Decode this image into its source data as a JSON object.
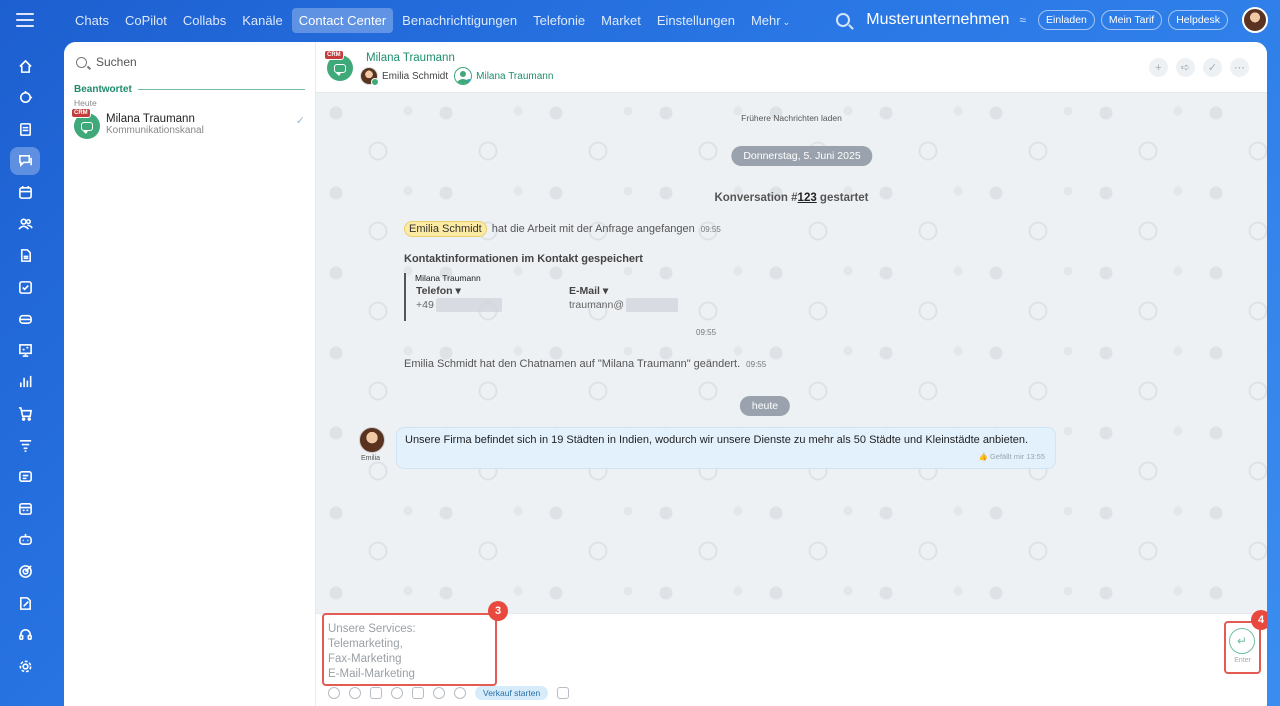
{
  "topnav": {
    "items": [
      "Chats",
      "CoPilot",
      "Collabs",
      "Kanäle",
      "Contact Center",
      "Benachrichtigungen",
      "Telefonie",
      "Market",
      "Einstellungen",
      "Mehr"
    ],
    "active_index": 4,
    "company": "Musterunternehmen",
    "buttons": [
      "Einladen",
      "Mein Tarif",
      "Helpdesk"
    ]
  },
  "sidebar_icons": [
    "home-icon",
    "puzzle-icon",
    "document-icon",
    "chat-icon",
    "calendar-icon",
    "people-icon",
    "file-icon",
    "checkbox-icon",
    "tray-icon",
    "presentation-icon",
    "chart-icon",
    "cart-icon",
    "funnel-icon",
    "crm-icon",
    "planner-icon",
    "robot-icon",
    "target-icon",
    "edit-doc-icon",
    "headset-icon",
    "gear-icon"
  ],
  "recent": {
    "search_placeholder": "Suchen",
    "section_title": "Beantwortet",
    "day_label": "Heute",
    "item": {
      "name": "Milana Traumann",
      "subtitle": "Kommunikationskanal",
      "badge": "CRM"
    }
  },
  "chat": {
    "title": "Milana Traumann",
    "members": [
      "Emilia Schmidt",
      "Milana Traumann"
    ],
    "load_more": "Frühere Nachrichten laden",
    "date_pill": "Donnerstag, 5. Juni 2025",
    "conversation_prefix": "Konversation #",
    "conversation_number": "123",
    "conversation_suffix": " gestartet",
    "sys1_name": "Emilia Schmidt",
    "sys1_text": "hat die Arbeit mit der Anfrage angefangen",
    "sys1_time": "09:55",
    "contact_header": "Kontaktinformationen im Kontakt gespeichert",
    "contact_name": "Milana Traumann",
    "phone_label": "Telefon ▾",
    "phone_value": "+49",
    "email_label": "E-Mail ▾",
    "email_value": "traumann@",
    "card_time": "09:55",
    "sys2_text": "Emilia Schmidt hat den Chatnamen auf \"Milana Traumann\" geändert.",
    "sys2_time": "09:55",
    "today_pill": "heute",
    "message_author": "Emilia",
    "message_text": "Unsere Firma befindet sich in 19 Städten in Indien, wodurch wir unsere Dienste zu mehr als 50 Städte und Kleinstädte anbieten.",
    "message_meta": "👍 Gefällt mir   13:55"
  },
  "composer": {
    "text": "Unsere Services:\nTelemarketing,\nFax-Marketing\nE-Mail-Marketing",
    "sale_button": "Verkauf starten",
    "send_label": "Enter",
    "callout_text": "3",
    "callout_send": "4"
  }
}
